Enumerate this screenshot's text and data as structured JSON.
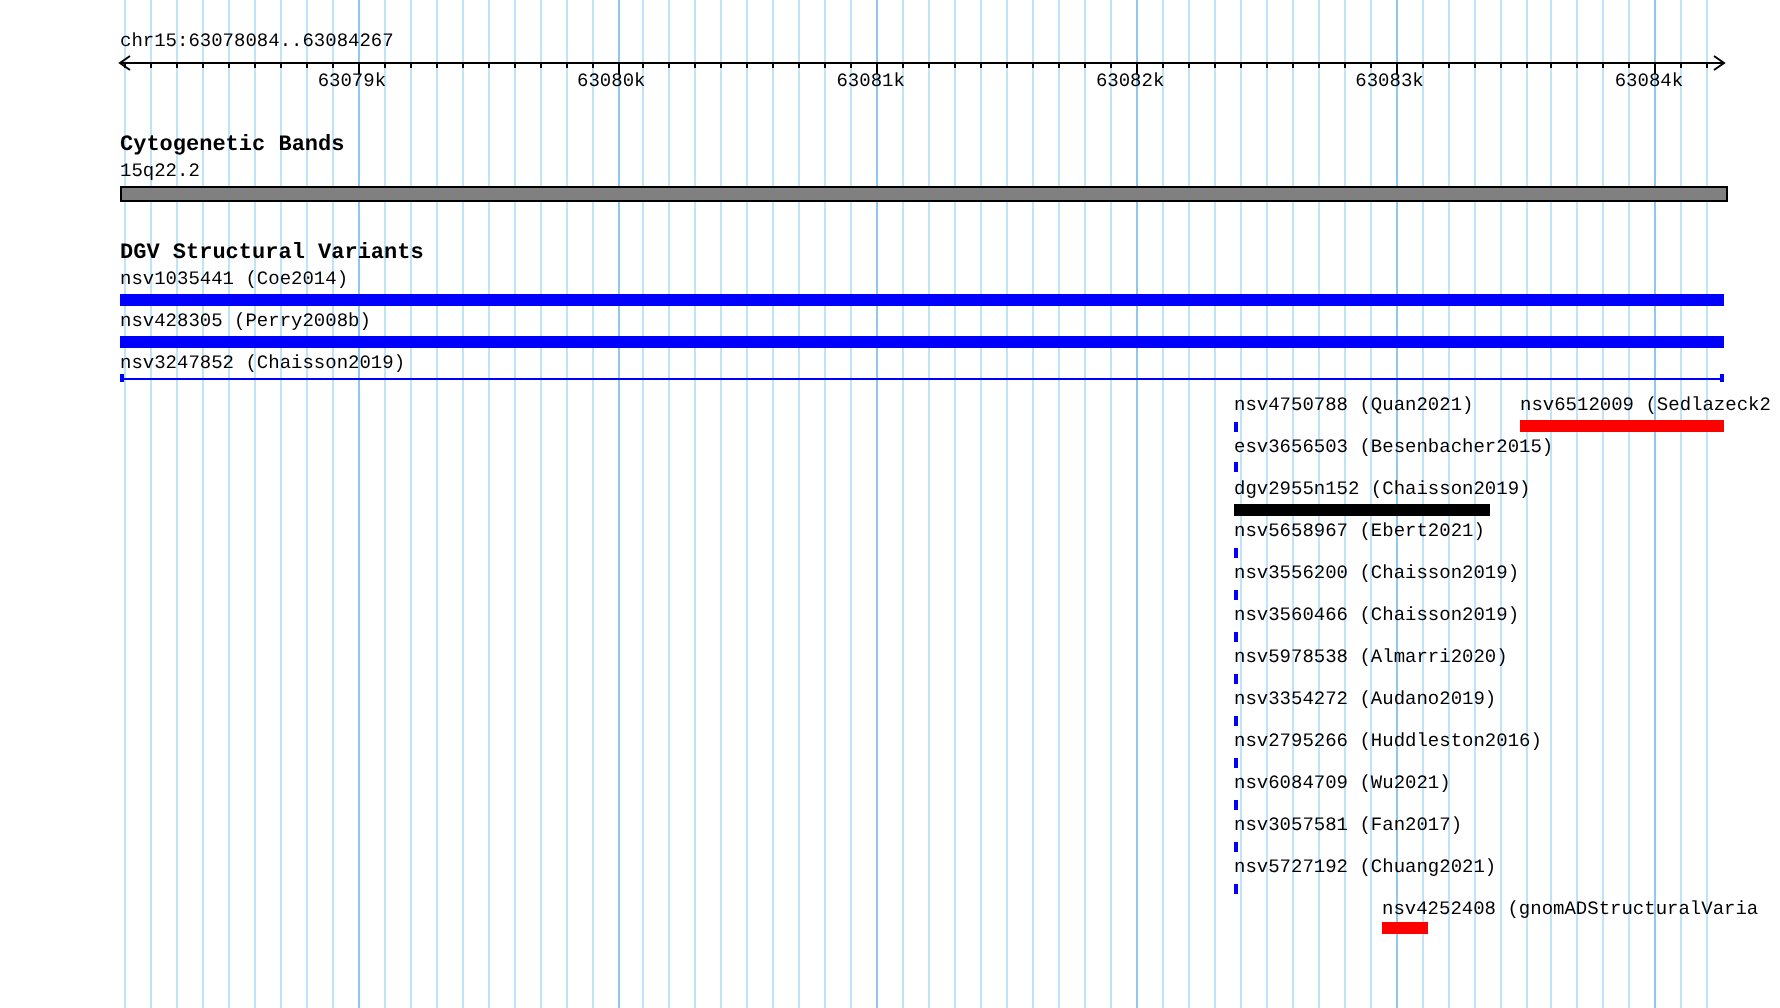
{
  "ruler": {
    "region": "chr15:63078084..63084267",
    "ticks": [
      "63079k",
      "63080k",
      "63081k",
      "63082k",
      "63083k",
      "63084k"
    ]
  },
  "tracks": [
    {
      "title": "Cytogenetic Bands",
      "features": [
        {
          "label": "15q22.2",
          "kind": "band",
          "color": "#808080"
        }
      ]
    },
    {
      "title": "DGV Structural Variants",
      "features": [
        {
          "label": "nsv1035441 (Coe2014)",
          "kind": "bar",
          "color": "#0000ff"
        },
        {
          "label": "nsv428305 (Perry2008b)",
          "kind": "bar",
          "color": "#0000ff"
        },
        {
          "label": "nsv3247852 (Chaisson2019)",
          "kind": "line",
          "color": "#0000ff"
        },
        {
          "label": "nsv4750788 (Quan2021)",
          "kind": "tick",
          "color": "#0000ff"
        },
        {
          "label": "nsv6512009 (Sedlazeck2",
          "kind": "bar",
          "color": "#ff0000"
        },
        {
          "label": "esv3656503 (Besenbacher2015)",
          "kind": "tick",
          "color": "#0000ff"
        },
        {
          "label": "dgv2955n152 (Chaisson2019)",
          "kind": "bar",
          "color": "#000000"
        },
        {
          "label": "nsv5658967 (Ebert2021)",
          "kind": "tick",
          "color": "#0000ff"
        },
        {
          "label": "nsv3556200 (Chaisson2019)",
          "kind": "tick",
          "color": "#0000ff"
        },
        {
          "label": "nsv3560466 (Chaisson2019)",
          "kind": "tick",
          "color": "#0000ff"
        },
        {
          "label": "nsv5978538 (Almarri2020)",
          "kind": "tick",
          "color": "#0000ff"
        },
        {
          "label": "nsv3354272 (Audano2019)",
          "kind": "tick",
          "color": "#0000ff"
        },
        {
          "label": "nsv2795266 (Huddleston2016)",
          "kind": "tick",
          "color": "#0000ff"
        },
        {
          "label": "nsv6084709 (Wu2021)",
          "kind": "tick",
          "color": "#0000ff"
        },
        {
          "label": "nsv3057581 (Fan2017)",
          "kind": "tick",
          "color": "#0000ff"
        },
        {
          "label": "nsv5727192 (Chuang2021)",
          "kind": "tick",
          "color": "#0000ff"
        },
        {
          "label": "nsv4252408 (gnomADStructuralVaria",
          "kind": "bar",
          "color": "#ff0000"
        }
      ]
    }
  ]
}
